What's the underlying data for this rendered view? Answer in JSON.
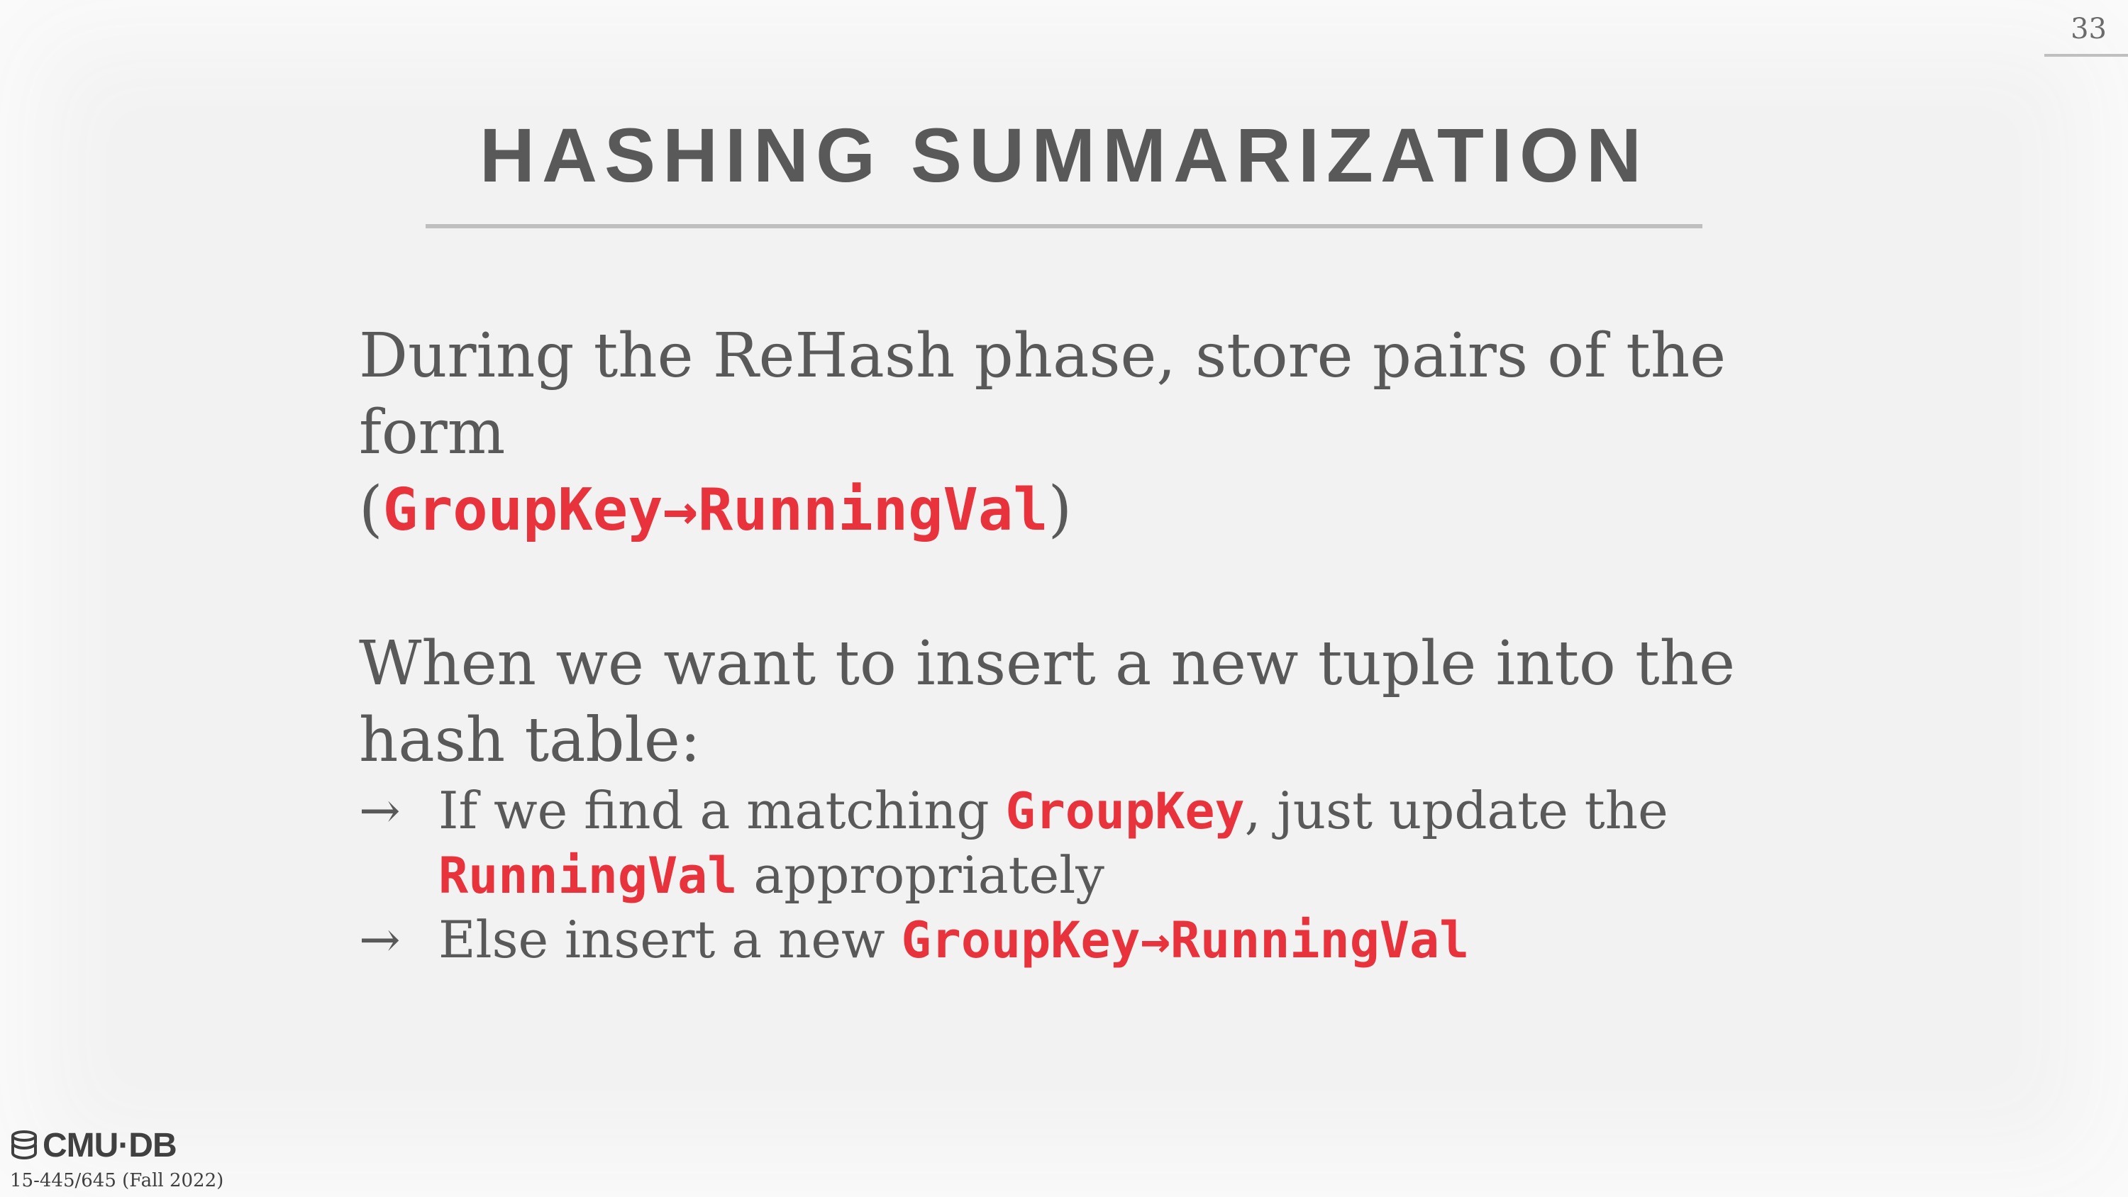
{
  "page_number": "33",
  "title": "HASHING SUMMARIZATION",
  "para1": {
    "text": "During the ReHash phase, store pairs of the form",
    "open_paren": "(",
    "code": "GroupKey→RunningVal",
    "close_paren": ")"
  },
  "para2": {
    "text": "When we want to insert a new tuple into the hash table:"
  },
  "bullets": [
    {
      "arrow": "→",
      "before": "If we find a matching ",
      "code1": "GroupKey",
      "middle": ", just update the ",
      "code2": "RunningVal",
      "after": " appropriately"
    },
    {
      "arrow": "→",
      "before": "Else insert a new ",
      "code1": "GroupKey→RunningVal"
    }
  ],
  "footer": {
    "logo_text": "CMU·DB",
    "course": "15-445/645 (Fall 2022)"
  },
  "colors": {
    "code": "#e8323c",
    "text": "#595959",
    "background": "#f2f2f2"
  }
}
